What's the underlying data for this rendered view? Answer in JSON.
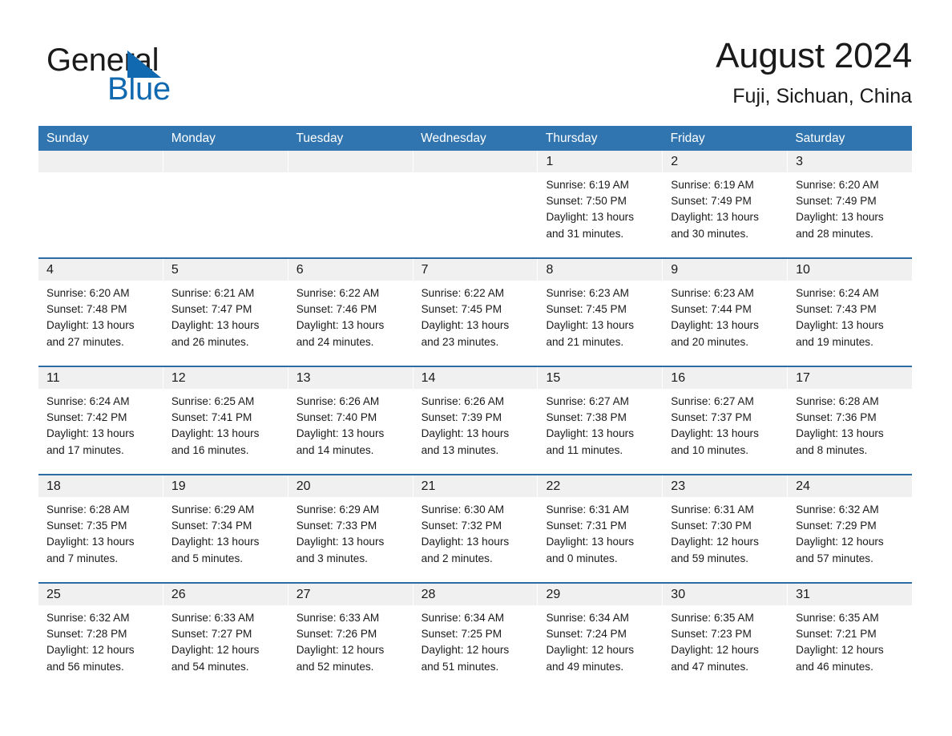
{
  "brand": {
    "word_one": "General",
    "word_two": "Blue",
    "triangle_color": "#1169b0",
    "text_color": "#1a1a1a"
  },
  "header": {
    "title": "August 2024",
    "subtitle": "Fuji, Sichuan, China"
  },
  "theme": {
    "header_blue": "#3175b0",
    "row_rule_blue": "#2e6da4",
    "day_band_gray": "#f0f0f0",
    "text": "#1a1a1a",
    "page_background": "#ffffff"
  },
  "weekdays": [
    "Sunday",
    "Monday",
    "Tuesday",
    "Wednesday",
    "Thursday",
    "Friday",
    "Saturday"
  ],
  "weeks": [
    [
      {
        "day": "",
        "empty": true,
        "sunrise": "",
        "sunset": "",
        "daylight_line1": "",
        "daylight_line2": ""
      },
      {
        "day": "",
        "empty": true,
        "sunrise": "",
        "sunset": "",
        "daylight_line1": "",
        "daylight_line2": ""
      },
      {
        "day": "",
        "empty": true,
        "sunrise": "",
        "sunset": "",
        "daylight_line1": "",
        "daylight_line2": ""
      },
      {
        "day": "",
        "empty": true,
        "sunrise": "",
        "sunset": "",
        "daylight_line1": "",
        "daylight_line2": ""
      },
      {
        "day": "1",
        "empty": false,
        "sunrise": "Sunrise: 6:19 AM",
        "sunset": "Sunset: 7:50 PM",
        "daylight_line1": "Daylight: 13 hours",
        "daylight_line2": "and 31 minutes."
      },
      {
        "day": "2",
        "empty": false,
        "sunrise": "Sunrise: 6:19 AM",
        "sunset": "Sunset: 7:49 PM",
        "daylight_line1": "Daylight: 13 hours",
        "daylight_line2": "and 30 minutes."
      },
      {
        "day": "3",
        "empty": false,
        "sunrise": "Sunrise: 6:20 AM",
        "sunset": "Sunset: 7:49 PM",
        "daylight_line1": "Daylight: 13 hours",
        "daylight_line2": "and 28 minutes."
      }
    ],
    [
      {
        "day": "4",
        "empty": false,
        "sunrise": "Sunrise: 6:20 AM",
        "sunset": "Sunset: 7:48 PM",
        "daylight_line1": "Daylight: 13 hours",
        "daylight_line2": "and 27 minutes."
      },
      {
        "day": "5",
        "empty": false,
        "sunrise": "Sunrise: 6:21 AM",
        "sunset": "Sunset: 7:47 PM",
        "daylight_line1": "Daylight: 13 hours",
        "daylight_line2": "and 26 minutes."
      },
      {
        "day": "6",
        "empty": false,
        "sunrise": "Sunrise: 6:22 AM",
        "sunset": "Sunset: 7:46 PM",
        "daylight_line1": "Daylight: 13 hours",
        "daylight_line2": "and 24 minutes."
      },
      {
        "day": "7",
        "empty": false,
        "sunrise": "Sunrise: 6:22 AM",
        "sunset": "Sunset: 7:45 PM",
        "daylight_line1": "Daylight: 13 hours",
        "daylight_line2": "and 23 minutes."
      },
      {
        "day": "8",
        "empty": false,
        "sunrise": "Sunrise: 6:23 AM",
        "sunset": "Sunset: 7:45 PM",
        "daylight_line1": "Daylight: 13 hours",
        "daylight_line2": "and 21 minutes."
      },
      {
        "day": "9",
        "empty": false,
        "sunrise": "Sunrise: 6:23 AM",
        "sunset": "Sunset: 7:44 PM",
        "daylight_line1": "Daylight: 13 hours",
        "daylight_line2": "and 20 minutes."
      },
      {
        "day": "10",
        "empty": false,
        "sunrise": "Sunrise: 6:24 AM",
        "sunset": "Sunset: 7:43 PM",
        "daylight_line1": "Daylight: 13 hours",
        "daylight_line2": "and 19 minutes."
      }
    ],
    [
      {
        "day": "11",
        "empty": false,
        "sunrise": "Sunrise: 6:24 AM",
        "sunset": "Sunset: 7:42 PM",
        "daylight_line1": "Daylight: 13 hours",
        "daylight_line2": "and 17 minutes."
      },
      {
        "day": "12",
        "empty": false,
        "sunrise": "Sunrise: 6:25 AM",
        "sunset": "Sunset: 7:41 PM",
        "daylight_line1": "Daylight: 13 hours",
        "daylight_line2": "and 16 minutes."
      },
      {
        "day": "13",
        "empty": false,
        "sunrise": "Sunrise: 6:26 AM",
        "sunset": "Sunset: 7:40 PM",
        "daylight_line1": "Daylight: 13 hours",
        "daylight_line2": "and 14 minutes."
      },
      {
        "day": "14",
        "empty": false,
        "sunrise": "Sunrise: 6:26 AM",
        "sunset": "Sunset: 7:39 PM",
        "daylight_line1": "Daylight: 13 hours",
        "daylight_line2": "and 13 minutes."
      },
      {
        "day": "15",
        "empty": false,
        "sunrise": "Sunrise: 6:27 AM",
        "sunset": "Sunset: 7:38 PM",
        "daylight_line1": "Daylight: 13 hours",
        "daylight_line2": "and 11 minutes."
      },
      {
        "day": "16",
        "empty": false,
        "sunrise": "Sunrise: 6:27 AM",
        "sunset": "Sunset: 7:37 PM",
        "daylight_line1": "Daylight: 13 hours",
        "daylight_line2": "and 10 minutes."
      },
      {
        "day": "17",
        "empty": false,
        "sunrise": "Sunrise: 6:28 AM",
        "sunset": "Sunset: 7:36 PM",
        "daylight_line1": "Daylight: 13 hours",
        "daylight_line2": "and 8 minutes."
      }
    ],
    [
      {
        "day": "18",
        "empty": false,
        "sunrise": "Sunrise: 6:28 AM",
        "sunset": "Sunset: 7:35 PM",
        "daylight_line1": "Daylight: 13 hours",
        "daylight_line2": "and 7 minutes."
      },
      {
        "day": "19",
        "empty": false,
        "sunrise": "Sunrise: 6:29 AM",
        "sunset": "Sunset: 7:34 PM",
        "daylight_line1": "Daylight: 13 hours",
        "daylight_line2": "and 5 minutes."
      },
      {
        "day": "20",
        "empty": false,
        "sunrise": "Sunrise: 6:29 AM",
        "sunset": "Sunset: 7:33 PM",
        "daylight_line1": "Daylight: 13 hours",
        "daylight_line2": "and 3 minutes."
      },
      {
        "day": "21",
        "empty": false,
        "sunrise": "Sunrise: 6:30 AM",
        "sunset": "Sunset: 7:32 PM",
        "daylight_line1": "Daylight: 13 hours",
        "daylight_line2": "and 2 minutes."
      },
      {
        "day": "22",
        "empty": false,
        "sunrise": "Sunrise: 6:31 AM",
        "sunset": "Sunset: 7:31 PM",
        "daylight_line1": "Daylight: 13 hours",
        "daylight_line2": "and 0 minutes."
      },
      {
        "day": "23",
        "empty": false,
        "sunrise": "Sunrise: 6:31 AM",
        "sunset": "Sunset: 7:30 PM",
        "daylight_line1": "Daylight: 12 hours",
        "daylight_line2": "and 59 minutes."
      },
      {
        "day": "24",
        "empty": false,
        "sunrise": "Sunrise: 6:32 AM",
        "sunset": "Sunset: 7:29 PM",
        "daylight_line1": "Daylight: 12 hours",
        "daylight_line2": "and 57 minutes."
      }
    ],
    [
      {
        "day": "25",
        "empty": false,
        "sunrise": "Sunrise: 6:32 AM",
        "sunset": "Sunset: 7:28 PM",
        "daylight_line1": "Daylight: 12 hours",
        "daylight_line2": "and 56 minutes."
      },
      {
        "day": "26",
        "empty": false,
        "sunrise": "Sunrise: 6:33 AM",
        "sunset": "Sunset: 7:27 PM",
        "daylight_line1": "Daylight: 12 hours",
        "daylight_line2": "and 54 minutes."
      },
      {
        "day": "27",
        "empty": false,
        "sunrise": "Sunrise: 6:33 AM",
        "sunset": "Sunset: 7:26 PM",
        "daylight_line1": "Daylight: 12 hours",
        "daylight_line2": "and 52 minutes."
      },
      {
        "day": "28",
        "empty": false,
        "sunrise": "Sunrise: 6:34 AM",
        "sunset": "Sunset: 7:25 PM",
        "daylight_line1": "Daylight: 12 hours",
        "daylight_line2": "and 51 minutes."
      },
      {
        "day": "29",
        "empty": false,
        "sunrise": "Sunrise: 6:34 AM",
        "sunset": "Sunset: 7:24 PM",
        "daylight_line1": "Daylight: 12 hours",
        "daylight_line2": "and 49 minutes."
      },
      {
        "day": "30",
        "empty": false,
        "sunrise": "Sunrise: 6:35 AM",
        "sunset": "Sunset: 7:23 PM",
        "daylight_line1": "Daylight: 12 hours",
        "daylight_line2": "and 47 minutes."
      },
      {
        "day": "31",
        "empty": false,
        "sunrise": "Sunrise: 6:35 AM",
        "sunset": "Sunset: 7:21 PM",
        "daylight_line1": "Daylight: 12 hours",
        "daylight_line2": "and 46 minutes."
      }
    ]
  ]
}
